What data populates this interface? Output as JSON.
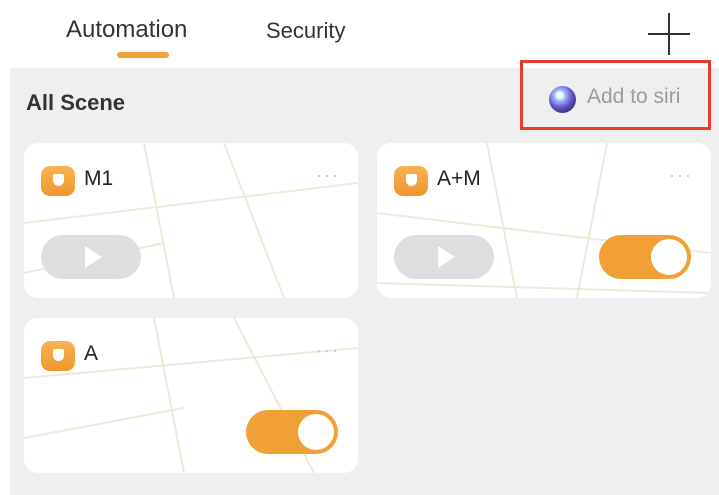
{
  "tabs": [
    {
      "label": "Automation",
      "active": true
    },
    {
      "label": "Security",
      "active": false
    }
  ],
  "header": {
    "add_icon": "plus-icon"
  },
  "section": {
    "title": "All Scene",
    "siri_label": "Add to siri",
    "siri_icon": "siri-icon"
  },
  "scenes": [
    {
      "name": "M1",
      "more": "···",
      "has_play": true,
      "toggle_on": false
    },
    {
      "name": "A+M",
      "more": "···",
      "has_play": true,
      "toggle_on": true
    },
    {
      "name": "A",
      "more": "···",
      "has_play": false,
      "toggle_on": true
    }
  ],
  "colors": {
    "accent": "#f0a035",
    "highlight_border": "#e83b2e",
    "background": "#efeff0"
  }
}
